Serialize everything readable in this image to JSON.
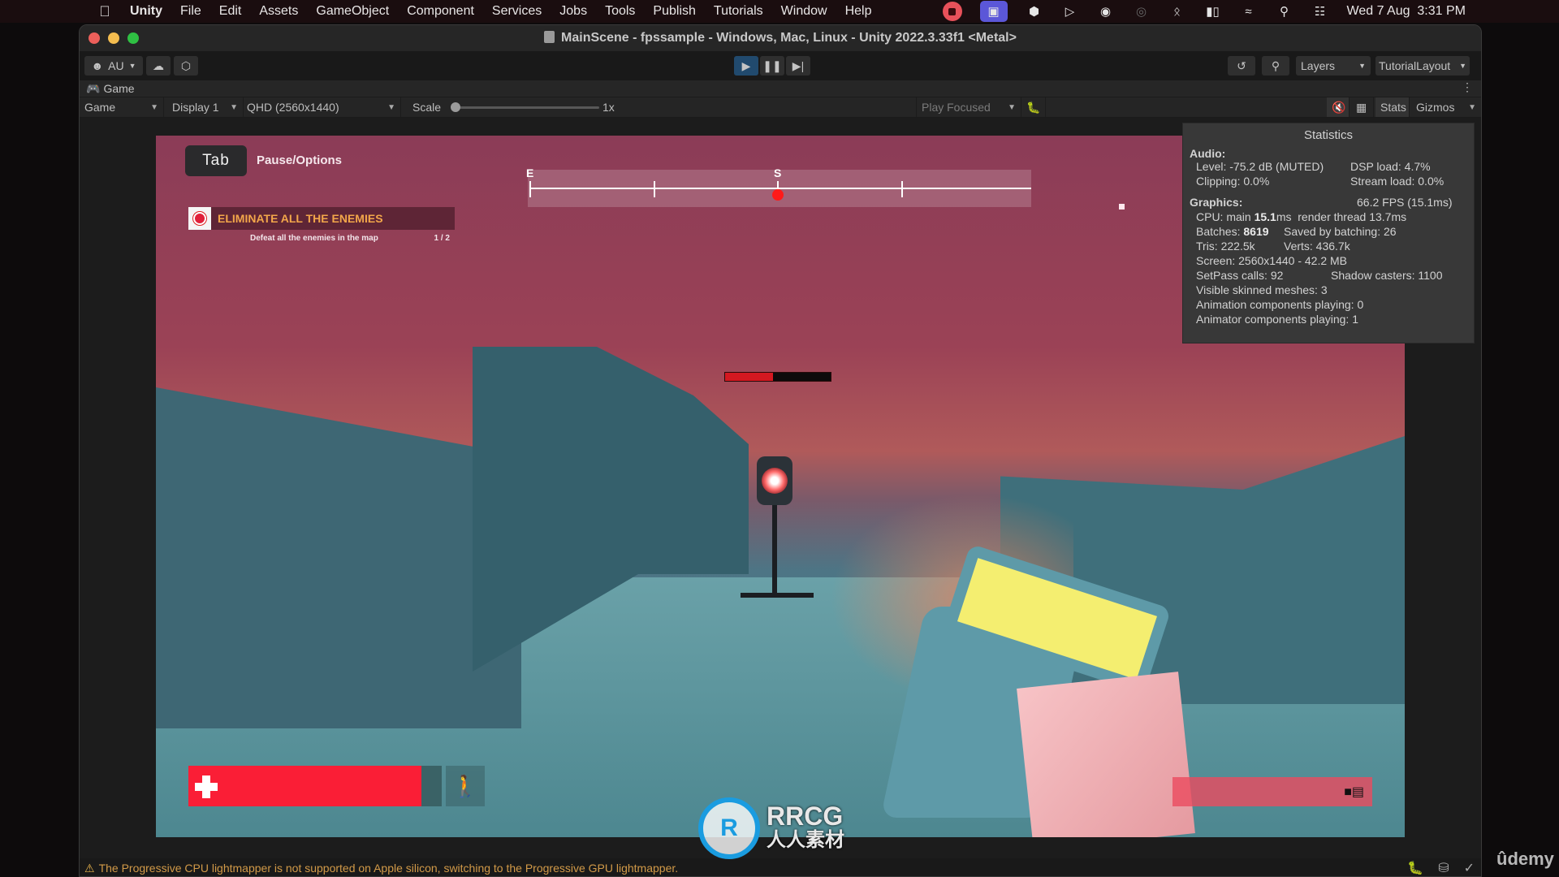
{
  "menubar": {
    "app": "Unity",
    "items": [
      "File",
      "Edit",
      "Assets",
      "GameObject",
      "Component",
      "Services",
      "Jobs",
      "Tools",
      "Publish",
      "Tutorials",
      "Window",
      "Help"
    ],
    "clock": "Wed 7 Aug  3:31 PM",
    "tray_icons": [
      "record-stop-icon",
      "screen-share-icon",
      "unity-hub-icon",
      "play-circle-icon",
      "user-circle-icon",
      "airdrop-icon",
      "bluetooth-icon",
      "battery-icon",
      "wifi-icon",
      "spotlight-search-icon",
      "control-center-icon"
    ]
  },
  "window": {
    "title": "MainScene - fpssample - Windows, Mac, Linux - Unity 2022.3.33f1 <Metal>"
  },
  "toolbar": {
    "account_label": "AU",
    "layers_label": "Layers",
    "layout_label": "TutorialLayout"
  },
  "game_tab": {
    "label": "Game"
  },
  "game_bar": {
    "view_mode": "Game",
    "display": "Display 1",
    "resolution": "QHD (2560x1440)",
    "scale_label": "Scale",
    "scale_value": "1x",
    "scale_fraction": 0.0,
    "play_mode": "Play Focused",
    "stats_label": "Stats",
    "gizmos_label": "Gizmos"
  },
  "hud": {
    "tab_key": "Tab",
    "tab_action": "Pause/Options",
    "objective": {
      "title": "ELIMINATE ALL THE ENEMIES",
      "description": "Defeat all the enemies in the map",
      "progress": "1 / 2"
    },
    "compass": {
      "labels": [
        {
          "text": "E",
          "position": 0.0
        },
        {
          "text": "S",
          "position": 0.5
        }
      ],
      "ticks": [
        0.0,
        0.25,
        0.5,
        0.75
      ],
      "marker_position": 0.5
    },
    "enemy_health": 0.45,
    "player_health": 0.92,
    "colors": {
      "health": "#fa1e36",
      "objective_title": "#f2a64a",
      "compass_marker": "#ff1a1a"
    }
  },
  "statistics": {
    "title": "Statistics",
    "audio_header": "Audio:",
    "level": "Level: -75.2 dB (MUTED)",
    "clipping": "Clipping: 0.0%",
    "dsp_load": "DSP load: 4.7%",
    "stream_load": "Stream load: 0.0%",
    "graphics_header": "Graphics:",
    "fps": "66.2 FPS (15.1ms)",
    "cpu_prefix": "CPU: main ",
    "cpu_main": "15.1",
    "cpu_suffix": "ms  render thread 13.7ms",
    "batches_prefix": "Batches: ",
    "batches": "8619",
    "saved_by_batching": "Saved by batching: 26",
    "tris": "Tris: 222.5k",
    "verts": "Verts: 436.7k",
    "screen": "Screen: 2560x1440 - 42.2 MB",
    "setpass": "SetPass calls: 92",
    "shadow_casters": "Shadow casters: 1100",
    "skinned_meshes": "Visible skinned meshes: 3",
    "animation_components": "Animation components playing: 0",
    "animator_components": "Animator components playing: 1"
  },
  "status_bar": {
    "message": "The Progressive CPU lightmapper is not supported on Apple silicon, switching to the Progressive GPU lightmapper."
  },
  "watermark": {
    "line1": "RRCG",
    "line2": "人人素材"
  },
  "udemy_label": "ûdemy"
}
